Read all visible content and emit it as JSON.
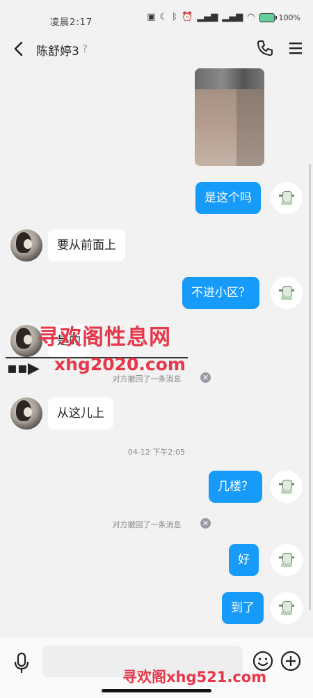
{
  "status_bar": {
    "time": "凌晨2:17",
    "battery": "100%",
    "icons": [
      "nfc-icon",
      "moon-icon",
      "bluetooth-icon",
      "alarm-icon",
      "signal-icon",
      "signal-icon",
      "wifi-icon",
      "battery-icon"
    ]
  },
  "header": {
    "contact_name": "陈舒婷3",
    "icons": [
      "back-arrow-icon",
      "ear-icon",
      "phone-icon",
      "menu-icon"
    ]
  },
  "messages": [
    {
      "type": "image",
      "sender": "self"
    },
    {
      "type": "text",
      "sender": "self",
      "text": "是这个吗"
    },
    {
      "type": "text",
      "sender": "other",
      "text": "要从前面上"
    },
    {
      "type": "text",
      "sender": "self",
      "text": "不进小区？"
    },
    {
      "type": "text",
      "sender": "other",
      "text": "是的"
    },
    {
      "type": "system",
      "text": "对方撤回了一条消息"
    },
    {
      "type": "text",
      "sender": "other",
      "text": "从这儿上"
    },
    {
      "type": "timestamp",
      "text": "04-12 下午2:05"
    },
    {
      "type": "text",
      "sender": "self",
      "text": "几楼？"
    },
    {
      "type": "system",
      "text": "对方撤回了一条消息"
    },
    {
      "type": "text",
      "sender": "self",
      "text": "好"
    },
    {
      "type": "text",
      "sender": "self",
      "text": "到了"
    }
  ],
  "watermark": {
    "line1": "寻欢阁性息网",
    "line2": "xhg2020.com",
    "bottom": "寻欢阁xhg521.com"
  },
  "input_bar": {
    "placeholder": "",
    "icons": [
      "mic-icon",
      "emoji-icon",
      "plus-icon"
    ]
  },
  "colors": {
    "outgoing_bubble": "#169bfa",
    "incoming_bubble": "#ffffff",
    "background": "#f2f2f2",
    "watermark": "#e8374a"
  }
}
